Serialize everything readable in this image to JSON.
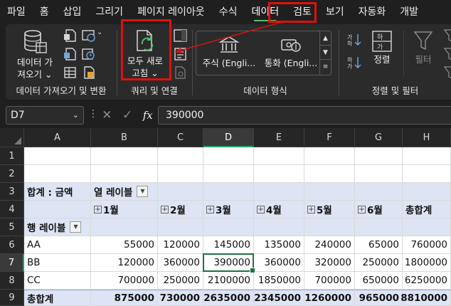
{
  "menu": {
    "tabs": [
      "파일",
      "홈",
      "삽입",
      "그리기",
      "페이지 레이아웃",
      "수식",
      "데이터",
      "검토",
      "보기",
      "자동화",
      "개발"
    ],
    "active": "데이터"
  },
  "ribbon": {
    "get_data": {
      "button_label_1": "데이터 가",
      "button_label_2": "져오기 ⌄",
      "group_label": "데이터 가져오기 및 변환"
    },
    "queries": {
      "refresh_label_1": "모두 새로",
      "refresh_label_2": "고침 ⌄",
      "group_label": "쿼리 및 연결"
    },
    "data_types": {
      "stocks": "주식 (Engli...",
      "currency": "통화 (Engli...",
      "group_label": "데이터 형식"
    },
    "sort_filter": {
      "sort_label": "정렬",
      "filter_label": "필터",
      "group_label": "정렬 및 필터"
    }
  },
  "formula_bar": {
    "name_box": "D7",
    "value": "390000",
    "fx": "fx"
  },
  "columns": [
    "A",
    "B",
    "C",
    "D",
    "E",
    "F",
    "G",
    "H"
  ],
  "rows": [
    "1",
    "2",
    "3",
    "4",
    "5",
    "6",
    "7",
    "8",
    "9"
  ],
  "pivot": {
    "sum_label": "합계 : 금액",
    "col_label": "열 레이블",
    "row_label": "행 레이블",
    "months": [
      "1월",
      "2월",
      "3월",
      "4월",
      "5월",
      "6월"
    ],
    "grand_total_header": "총합계",
    "data_rows": [
      {
        "label": "AA",
        "values": [
          "55000",
          "120000",
          "145000",
          "135000",
          "240000",
          "65000",
          "760000"
        ]
      },
      {
        "label": "BB",
        "values": [
          "120000",
          "360000",
          "390000",
          "360000",
          "320000",
          "250000",
          "1800000"
        ]
      },
      {
        "label": "CC",
        "values": [
          "700000",
          "250000",
          "2100000",
          "1850000",
          "700000",
          "650000",
          "6250000"
        ]
      }
    ],
    "total_row": {
      "label": "총합계",
      "values": [
        "875000",
        "730000",
        "2635000",
        "2345000",
        "1260000",
        "965000",
        "8810000"
      ]
    }
  },
  "colors": {
    "accent": "#21a366",
    "highlight": "#e01010",
    "pivot_band": "#dde4f3"
  }
}
